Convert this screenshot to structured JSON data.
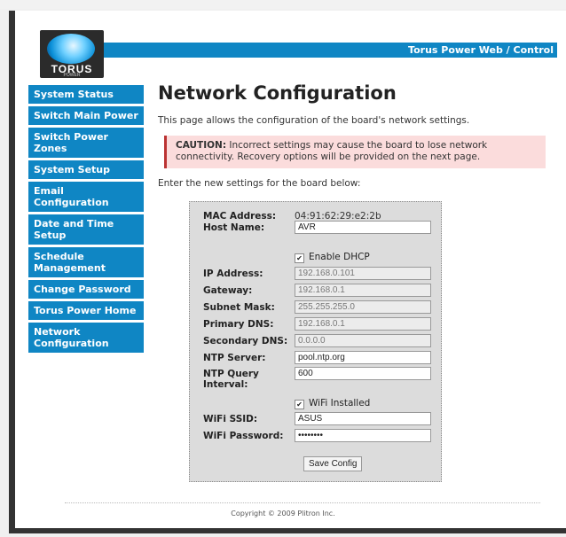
{
  "header": {
    "title": "Torus Power Web / Control",
    "logo_text": "TORUS",
    "logo_sub": "POWER"
  },
  "sidebar": {
    "items": [
      {
        "label": "System Status"
      },
      {
        "label": "Switch Main Power"
      },
      {
        "label": "Switch Power Zones"
      },
      {
        "label": "System Setup"
      },
      {
        "label": "Email Configuration"
      },
      {
        "label": "Date and Time Setup"
      },
      {
        "label": "Schedule Management"
      },
      {
        "label": "Change Password"
      },
      {
        "label": "Torus Power Home"
      },
      {
        "label": "Network Configuration"
      }
    ]
  },
  "page": {
    "title": "Network Configuration",
    "intro": "This page allows the configuration of the board's network settings.",
    "caution_label": "CAUTION:",
    "caution_text": "Incorrect settings may cause the board to lose network connectivity. Recovery options will be provided on the next page.",
    "enter_text": "Enter the new settings for the board below:"
  },
  "form": {
    "mac_label": "MAC Address:",
    "mac_value": "04:91:62:29:e2:2b",
    "host_label": "Host Name:",
    "host_value": "AVR",
    "dhcp_label": "Enable DHCP",
    "ip_label": "IP Address:",
    "ip_value": "192.168.0.101",
    "gateway_label": "Gateway:",
    "gateway_value": "192.168.0.1",
    "subnet_label": "Subnet Mask:",
    "subnet_value": "255.255.255.0",
    "pdns_label": "Primary DNS:",
    "pdns_value": "192.168.0.1",
    "sdns_label": "Secondary DNS:",
    "sdns_value": "0.0.0.0",
    "ntp_label": "NTP Server:",
    "ntp_value": "pool.ntp.org",
    "ntpq_label": "NTP Query Interval:",
    "ntpq_value": "600",
    "wifi_label": "WiFi Installed",
    "ssid_label": "WiFi SSID:",
    "ssid_value": "ASUS",
    "pass_label": "WiFi Password:",
    "pass_value": "••••••••",
    "save_label": "Save Config"
  },
  "footer": {
    "copyright": "Copyright © 2009 Plitron Inc."
  },
  "colors": {
    "accent": "#0f86c4",
    "caution_bg": "#fbdcdc",
    "caution_border": "#b33333"
  }
}
